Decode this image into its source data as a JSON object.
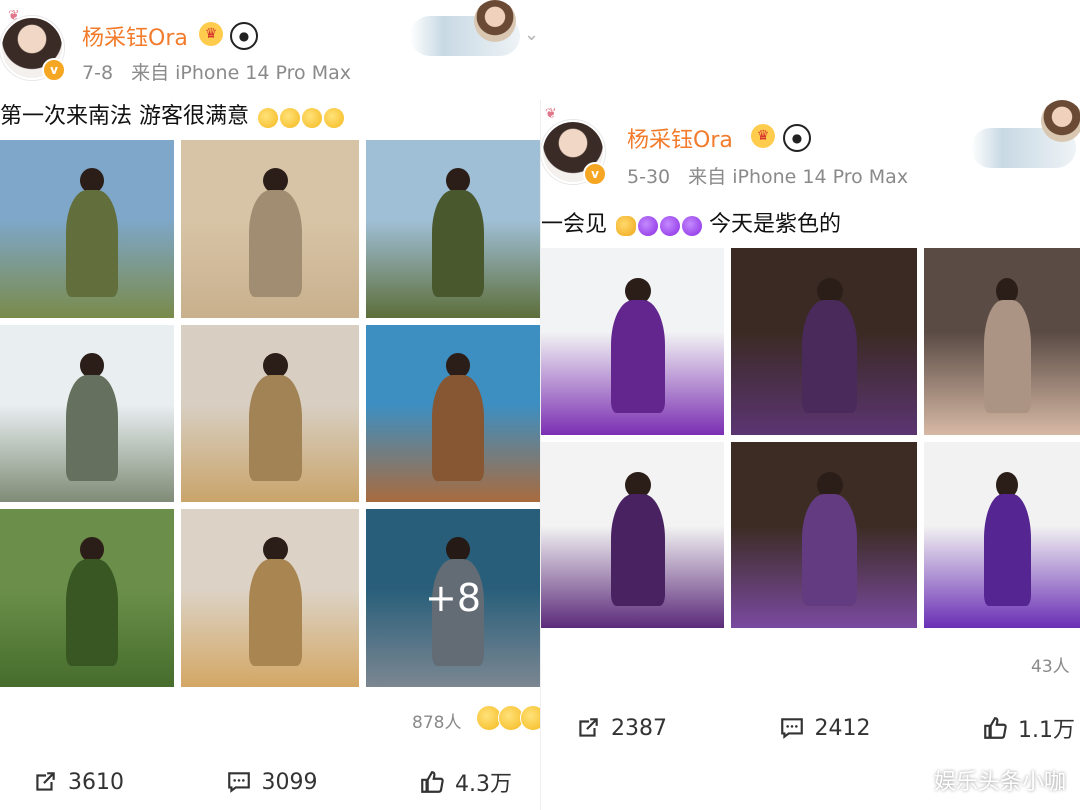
{
  "left_post": {
    "user_name": "杨采钰Ora",
    "date": "7-8",
    "source": "来自 iPhone 14 Pro Max",
    "text": "第一次来南法 游客很满意",
    "more_count": "+8",
    "viewers": "878人",
    "repost_count": "3610",
    "comment_count": "3099",
    "like_count": "4.3万",
    "photos": [
      {
        "top": "#7ea7c9",
        "bottom": "#7a8a4a"
      },
      {
        "top": "#d7c4a6",
        "bottom": "#c9b08d"
      },
      {
        "top": "#9fbfd6",
        "bottom": "#5d6e3a"
      },
      {
        "top": "#e9eef1",
        "bottom": "#7f8c76"
      },
      {
        "top": "#d8cfc2",
        "bottom": "#c9a46a"
      },
      {
        "top": "#3d8fc2",
        "bottom": "#a96b3e"
      },
      {
        "top": "#6b8f4b",
        "bottom": "#466d2c"
      },
      {
        "top": "#dcd3c6",
        "bottom": "#d3a765"
      },
      {
        "top": "#2f6c8c",
        "bottom": "#8d9aa6"
      }
    ]
  },
  "right_post": {
    "user_name": "杨采钰Ora",
    "date": "5-30",
    "source": "来自 iPhone 14 Pro Max",
    "text": "一会见",
    "text_suffix": "今天是紫色的",
    "viewers": "43人",
    "repost_count": "2387",
    "comment_count": "2412",
    "like_count": "1.1万",
    "photos": [
      {
        "top": "#f2f3f4",
        "bottom": "#7b2fb2"
      },
      {
        "top": "#3b2a24",
        "bottom": "#5b3572"
      },
      {
        "top": "#5a4b45",
        "bottom": "#d7b9a5"
      },
      {
        "top": "#f3f3f3",
        "bottom": "#5b2a7a"
      },
      {
        "top": "#3c2c24",
        "bottom": "#7a4aa0"
      },
      {
        "top": "#f2f2f2",
        "bottom": "#6a2fb5"
      }
    ]
  },
  "watermark": "娱乐头条小咖",
  "colors": {
    "name": "#f27c2c",
    "meta": "#8a8a8a",
    "vip_badge": "#f5a623",
    "accent_purple": "#8a2be2"
  }
}
